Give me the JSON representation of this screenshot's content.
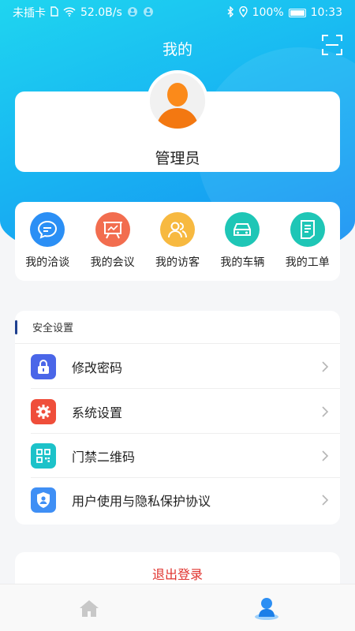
{
  "status_bar": {
    "carrier": "未插卡",
    "network_speed": "52.0B/s",
    "battery": "100%",
    "time": "10:33"
  },
  "header": {
    "title": "我的",
    "scan_icon": "scan-icon"
  },
  "profile": {
    "name": "管理员",
    "avatar_icon": "user-avatar-icon"
  },
  "quick_actions": [
    {
      "label": "我的洽谈",
      "icon": "chat-icon",
      "color": "#2b8ff5"
    },
    {
      "label": "我的会议",
      "icon": "meeting-board-icon",
      "color": "#f26d4f"
    },
    {
      "label": "我的访客",
      "icon": "visitors-icon",
      "color": "#f7b940"
    },
    {
      "label": "我的车辆",
      "icon": "car-icon",
      "color": "#1ec6b6"
    },
    {
      "label": "我的工单",
      "icon": "work-order-icon",
      "color": "#1ec6b6"
    }
  ],
  "settings": {
    "section_title": "安全设置",
    "items": [
      {
        "label": "修改密码",
        "icon": "lock-icon",
        "color": "#4a66e8"
      },
      {
        "label": "系统设置",
        "icon": "gear-icon",
        "color": "#ef4e3a"
      },
      {
        "label": "门禁二维码",
        "icon": "qr-code-icon",
        "color": "#1cc2c9"
      },
      {
        "label": "用户使用与隐私保护协议",
        "icon": "shield-user-icon",
        "color": "#3f8ff5"
      }
    ]
  },
  "logout": {
    "label": "退出登录",
    "color": "#e0322d"
  },
  "tab_bar": {
    "tabs": [
      {
        "icon": "home-icon",
        "active": false
      },
      {
        "icon": "profile-icon",
        "active": true
      }
    ]
  }
}
